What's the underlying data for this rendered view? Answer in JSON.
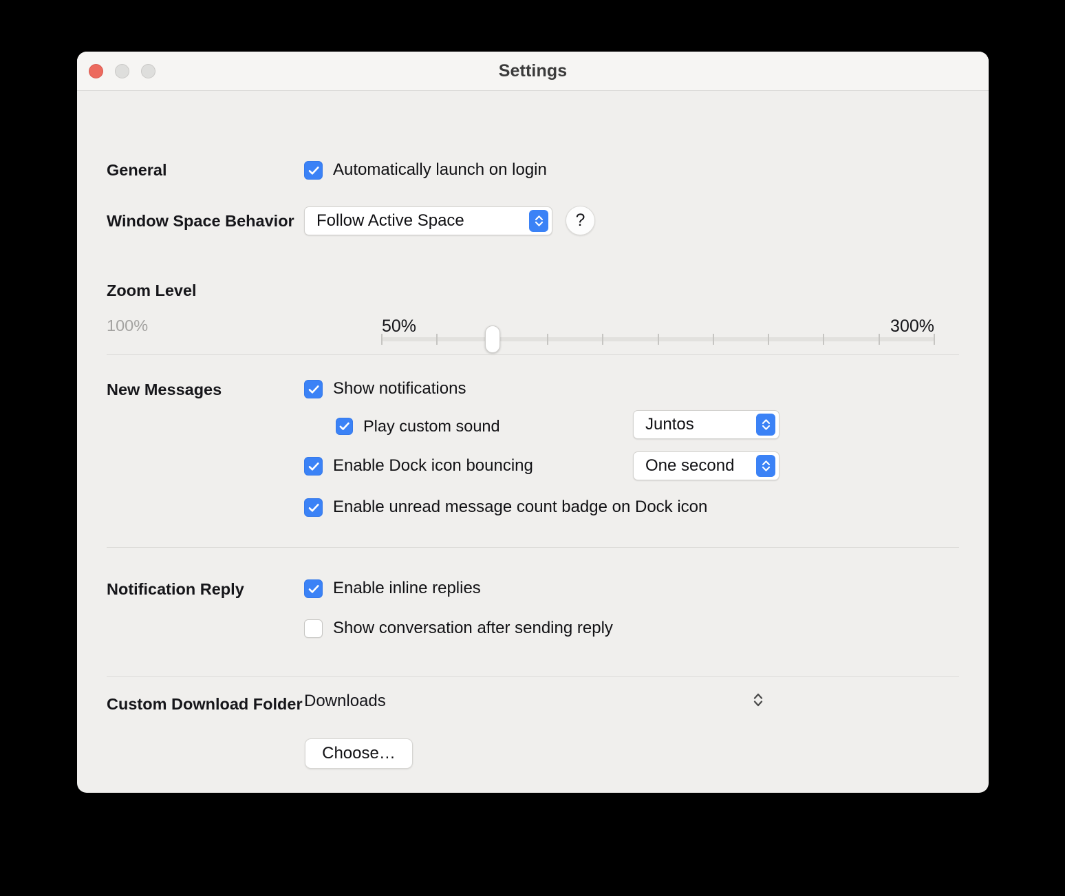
{
  "window": {
    "title": "Settings",
    "traffic_lights": [
      {
        "name": "close",
        "color": "#ec6a5e"
      },
      {
        "name": "minimize",
        "color": "#dededc"
      },
      {
        "name": "maximize",
        "color": "#dededc"
      }
    ]
  },
  "sections": {
    "general": {
      "label": "General",
      "auto_launch": {
        "label": "Automatically launch on login",
        "checked": true
      }
    },
    "window_space_behavior": {
      "label": "Window Space Behavior",
      "popup_value": "Follow Active Space",
      "help_glyph": "?"
    },
    "zoom_level": {
      "label": "Zoom Level",
      "current_value": "100%",
      "min_label": "50%",
      "max_label": "300%",
      "tick_count": 11,
      "thumb_position_percent": 20
    },
    "new_messages": {
      "label": "New Messages",
      "show_notifications": {
        "label": "Show notifications",
        "checked": true
      },
      "play_custom_sound": {
        "label": "Play custom sound",
        "checked": true,
        "popup_value": "Juntos"
      },
      "dock_bouncing": {
        "label": "Enable Dock icon bouncing",
        "checked": true,
        "popup_value": "One second"
      },
      "unread_badge": {
        "label": "Enable unread message count badge on Dock icon",
        "checked": true
      }
    },
    "notification_reply": {
      "label": "Notification Reply",
      "inline_replies": {
        "label": "Enable inline replies",
        "checked": true
      },
      "show_conversation": {
        "label": "Show conversation after sending reply",
        "checked": false
      }
    },
    "custom_download_folder": {
      "label": "Custom Download Folder",
      "folder_value": "Downloads",
      "choose_label": "Choose…"
    }
  },
  "colors": {
    "accent": "#3b82f6",
    "window_bg": "#f0efed",
    "titlebar_bg": "#f6f5f3",
    "divider": "#dcdbd8",
    "text": "#111114",
    "muted_text": "#a3a2a0"
  }
}
